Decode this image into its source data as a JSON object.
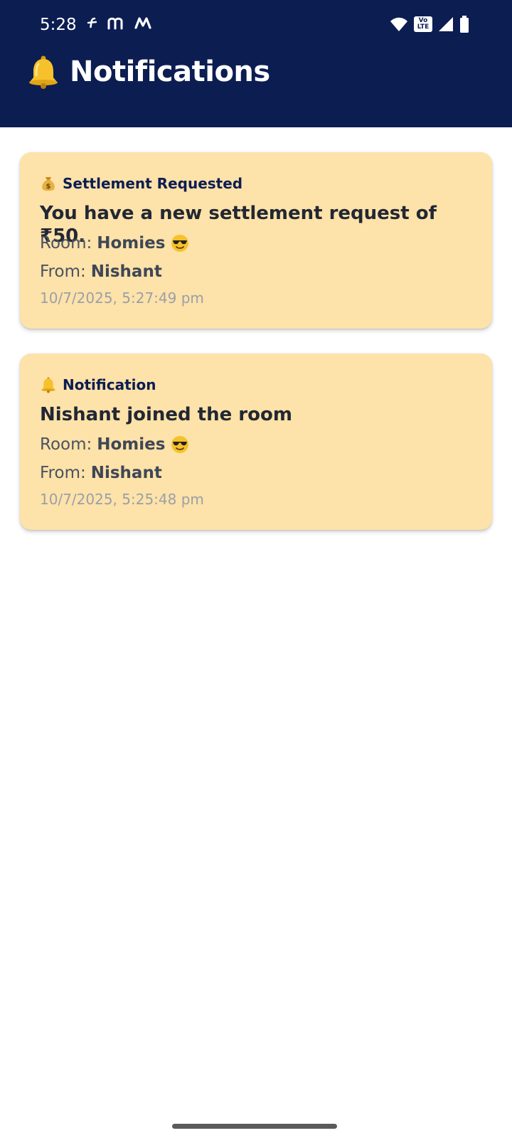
{
  "status_bar": {
    "time": "5:28",
    "left_icons": [
      "flipkart-icon",
      "myntra-icon",
      "meesho-icon"
    ],
    "right_icons": [
      "wifi-icon",
      "volte-icon",
      "signal-icon",
      "battery-icon"
    ],
    "volte_label_top": "Vo",
    "volte_label_bottom": "LTE"
  },
  "header": {
    "title": "Notifications",
    "title_icon": "bell-icon",
    "background_color": "#0c1d52"
  },
  "notifications": [
    {
      "type_icon": "money-bag-icon",
      "type_label": "Settlement Requested",
      "message": "You have a new settlement request of ₹50.",
      "room_label": "Room:",
      "room_value": "Homies",
      "room_emoji": "sunglasses-face-icon",
      "from_label": "From:",
      "from_value": "Nishant",
      "timestamp": "10/7/2025, 5:27:49 pm"
    },
    {
      "type_icon": "bell-icon",
      "type_label": "Notification",
      "message": "Nishant joined the room",
      "room_label": "Room:",
      "room_value": "Homies",
      "room_emoji": "sunglasses-face-icon",
      "from_label": "From:",
      "from_value": "Nishant",
      "timestamp": "10/7/2025, 5:25:48 pm"
    }
  ],
  "colors": {
    "card_background": "#fde2a9",
    "accent_navy": "#0c1d52",
    "timestamp_gray": "#9aa0a8"
  }
}
